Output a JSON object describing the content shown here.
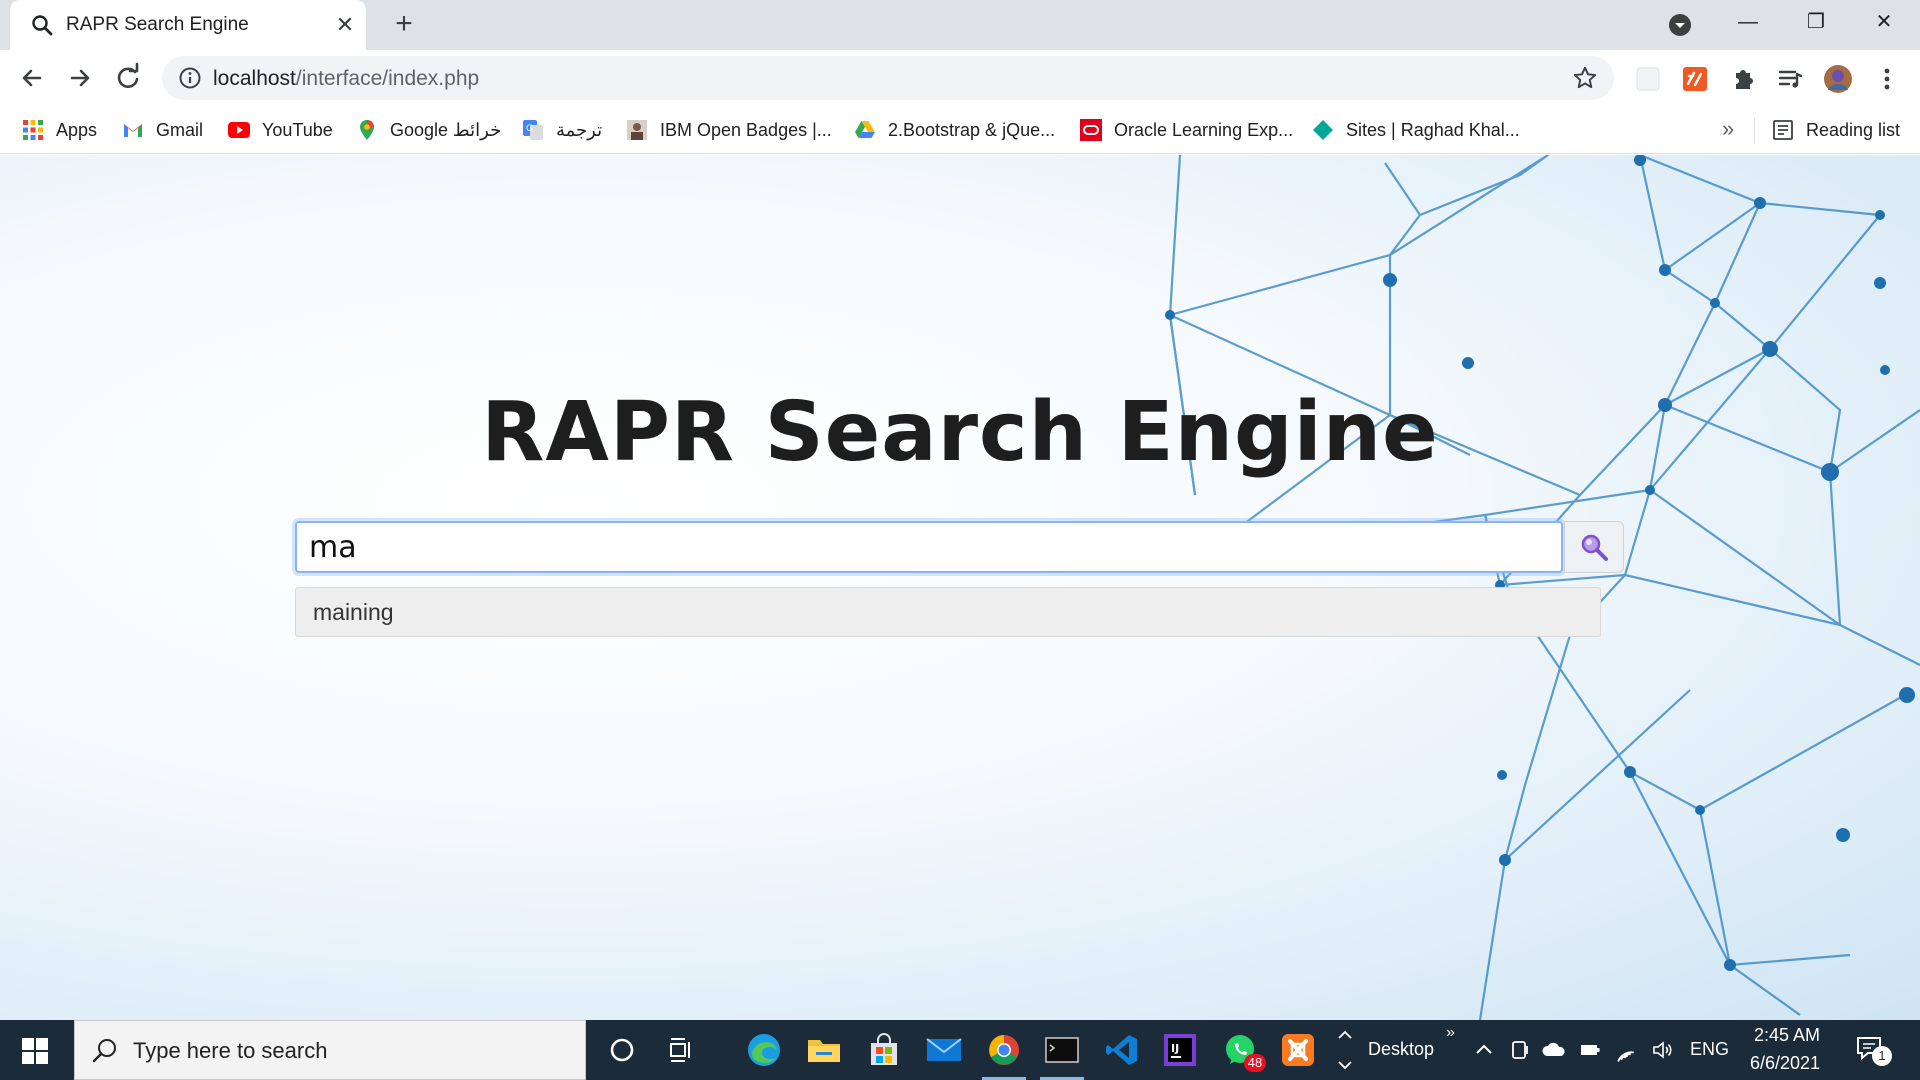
{
  "browser": {
    "tab": {
      "title": "RAPR Search Engine"
    },
    "address": {
      "host": "localhost",
      "path": "/interface/index.php"
    },
    "bookmarks": [
      {
        "label": "Apps",
        "icon": "apps-grid-icon"
      },
      {
        "label": "Gmail",
        "icon": "gmail-icon"
      },
      {
        "label": "YouTube",
        "icon": "youtube-icon"
      },
      {
        "label": "Google خرائط",
        "icon": "google-maps-icon"
      },
      {
        "label": "ترجمة",
        "icon": "google-translate-icon"
      },
      {
        "label": "IBM Open Badges |...",
        "icon": "ibm-badge-icon"
      },
      {
        "label": "2.Bootstrap & jQue...",
        "icon": "google-drive-icon"
      },
      {
        "label": "Oracle Learning Exp...",
        "icon": "oracle-icon"
      },
      {
        "label": "Sites | Raghad Khal...",
        "icon": "google-sites-icon"
      }
    ],
    "reading_list": "Reading list"
  },
  "page": {
    "title": "RAPR Search Engine",
    "search_value": "ma",
    "suggestions": [
      "maining"
    ]
  },
  "taskbar": {
    "search_placeholder": "Type here to search",
    "desktop_label": "Desktop",
    "language": "ENG",
    "time": "2:45 AM",
    "date": "6/6/2021",
    "whatsapp_badge": "48",
    "notification_badge": "1"
  },
  "colors": {
    "accent": "#8ab4f8",
    "taskbar": "#1c2b3a",
    "tabstrip": "#dee1e6"
  }
}
